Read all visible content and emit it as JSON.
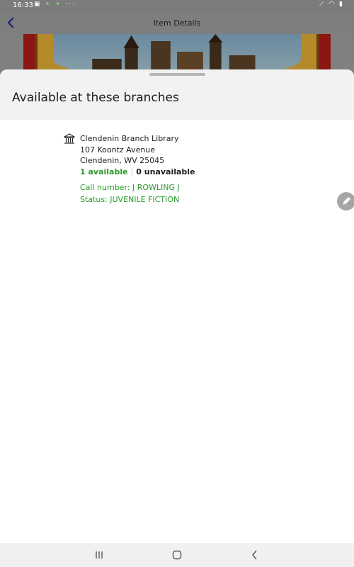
{
  "status_bar": {
    "time": "16:33",
    "left_icons": [
      "image-icon",
      "android-icon",
      "android-icon",
      "more-icon"
    ],
    "right_icons": [
      "signal-slash-icon",
      "wifi-icon",
      "battery-icon"
    ]
  },
  "app_bar": {
    "title": "Item Details",
    "back_icon": "chevron-left-icon"
  },
  "sheet": {
    "title": "Available at these branches",
    "branches": [
      {
        "name": "Clendenin Branch Library",
        "address_line1": "107 Koontz Avenue",
        "address_line2": "Clendenin, WV 25045",
        "available": "1 available",
        "separator": "|",
        "unavailable": "0 unavailable",
        "call_number": "Call number: J ROWLING J",
        "status": "Status: JUVENILE FICTION"
      }
    ]
  },
  "colors": {
    "available_green": "#2a9a2a",
    "back_arrow_blue": "#1a237e"
  },
  "nav_bar": {
    "icons": [
      "recent-apps-icon",
      "home-icon",
      "back-icon"
    ]
  }
}
